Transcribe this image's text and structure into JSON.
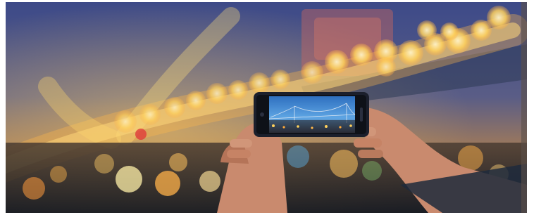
{
  "image": {
    "subject": "hands-holding-smartphone-photographing-bridge-at-night",
    "palette": {
      "sky_top": "#3e4b8a",
      "sky_mid": "#5c5f86",
      "bokeh_warm": "#ffd15c",
      "bokeh_orange": "#ff9a2a",
      "ground_dark": "#1d2534",
      "phone_body": "#1b1f2c",
      "phone_screen_sky": "#3e8ad1",
      "skin": "#c98a6e",
      "frame_border": "#ffffff"
    }
  }
}
